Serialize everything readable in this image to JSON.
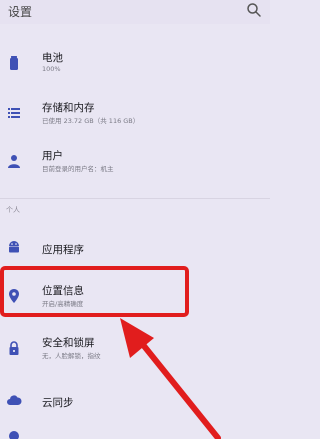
{
  "header": {
    "title": "设置",
    "search_icon": "search-icon"
  },
  "items_top": [
    {
      "label": "电池",
      "sub": "100%",
      "icon": "battery-icon"
    },
    {
      "label": "存储和内存",
      "sub": "已使用 23.72 GB（共 116 GB）",
      "icon": "storage-icon"
    },
    {
      "label": "用户",
      "sub": "目前登录的用户名：机主",
      "icon": "person-icon"
    }
  ],
  "section_personal": "个人",
  "items_personal": [
    {
      "label": "应用程序",
      "icon": "android-icon"
    },
    {
      "label": "位置信息",
      "sub": "开启/高精确度",
      "icon": "location-icon"
    },
    {
      "label": "安全和锁屏",
      "sub": "无，人脸解锁，指纹",
      "icon": "lock-icon"
    },
    {
      "label": "云同步",
      "icon": "cloud-icon"
    }
  ],
  "colors": {
    "accent": "#3f51b5",
    "highlight_box": "#e11d1d",
    "arrow": "#e11d1d",
    "background": "#e9e6f3"
  }
}
